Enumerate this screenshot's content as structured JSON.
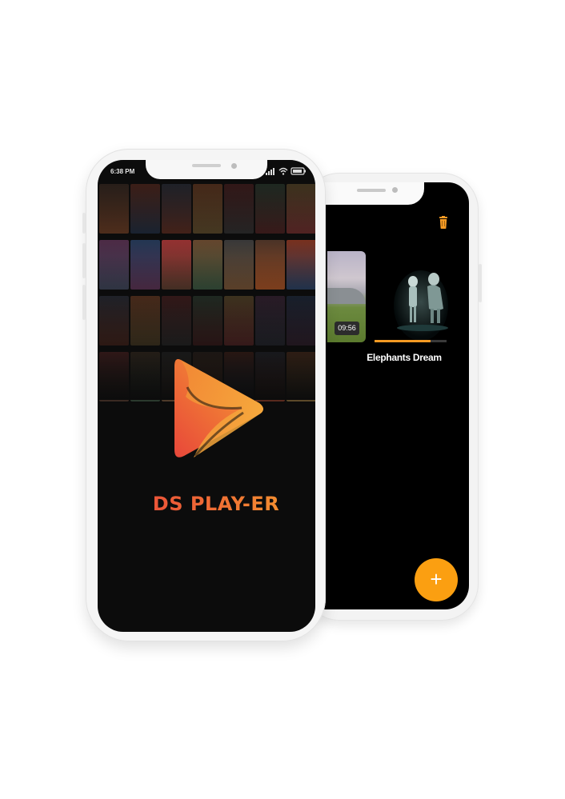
{
  "colors": {
    "accent": "#fb9f11",
    "logo_start": "#e8473a",
    "logo_end": "#f7b740",
    "screen_bg": "#000000"
  },
  "splash_phone": {
    "status_bar": {
      "time": "6:38 PM",
      "icons": [
        "alarm-icon",
        "signal-icon",
        "wifi-icon",
        "battery-icon"
      ]
    },
    "logo": "play-triangle-logo",
    "app_name": "DS PLAY-ER"
  },
  "library_phone": {
    "toolbar_icon": "trash-icon",
    "videos": [
      {
        "thumbnail": "landscape-thumbnail",
        "duration": "09:56",
        "title": ""
      },
      {
        "thumbnail": "elephants-dream-thumbnail",
        "title": "Elephants Dream",
        "progress": 0.78
      }
    ],
    "fab_icon": "plus-icon",
    "fab_label": "+"
  }
}
